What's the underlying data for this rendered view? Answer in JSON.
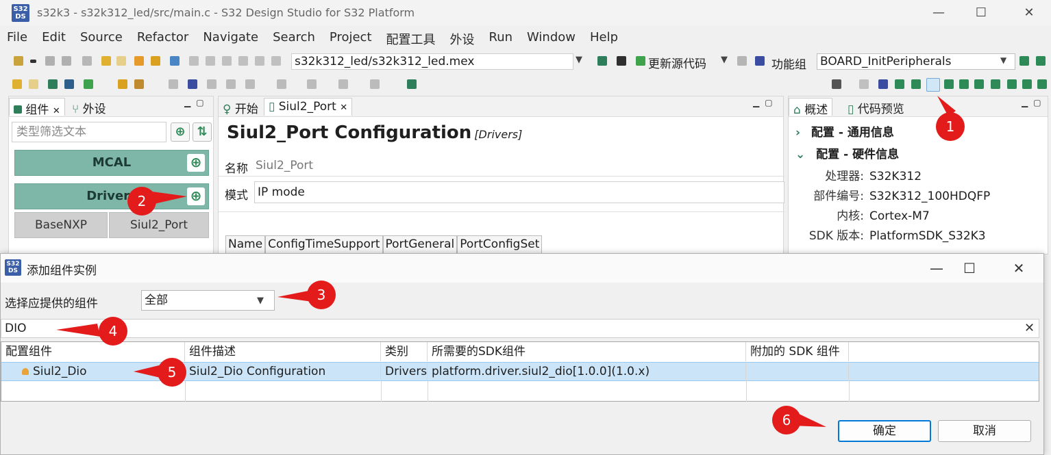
{
  "window": {
    "title": "s32k3 - s32k312_led/src/main.c - S32 Design Studio for S32 Platform",
    "logo_text": "S32 DS",
    "minimize": "—",
    "maximize": "☐",
    "close": "✕"
  },
  "menu": [
    "File",
    "Edit",
    "Source",
    "Refactor",
    "Navigate",
    "Search",
    "Project",
    "配置工具",
    "外设",
    "Run",
    "Window",
    "Help"
  ],
  "toolbar": {
    "mex_file": "s32k312_led/s32k312_led.mex",
    "update_code_label": "更新源代码",
    "function_group_label": "功能组",
    "function_group_value": "BOARD_InitPeripherals"
  },
  "left_panel": {
    "tabs": [
      "组件",
      "外设"
    ],
    "filter_placeholder": "类型筛选文本",
    "groups": [
      {
        "label": "MCAL"
      },
      {
        "label": "Drivers"
      }
    ],
    "items": [
      "BaseNXP",
      "Siul2_Port"
    ]
  },
  "center_panel": {
    "tabs": [
      "开始",
      "Siul2_Port"
    ],
    "heading": "Siul2_Port Configuration",
    "heading_sub": "[Drivers]",
    "name_label": "名称",
    "name_value": "Siul2_Port",
    "mode_label": "模式",
    "mode_value": "IP mode",
    "subtabs": [
      "Name",
      "ConfigTimeSupport",
      "PortGeneral",
      "PortConfigSet"
    ]
  },
  "right_panel": {
    "tabs": [
      "概述",
      "代码预览"
    ],
    "sections": [
      {
        "label": "配置 - 通用信息",
        "chevron": "›"
      },
      {
        "label": "配置 - 硬件信息",
        "chevron": "⌄"
      }
    ],
    "info": [
      {
        "k": "处理器:",
        "v": "S32K312"
      },
      {
        "k": "部件编号:",
        "v": "S32K312_100HDQFP"
      },
      {
        "k": "内核:",
        "v": "Cortex-M7"
      },
      {
        "k": "SDK 版本:",
        "v": "PlatformSDK_S32K3"
      }
    ]
  },
  "dialog": {
    "title": "添加组件实例",
    "provide_label": "选择应提供的组件",
    "provide_value": "全部",
    "search_value": "DIO",
    "columns": [
      "配置组件",
      "组件描述",
      "类别",
      "所需要的SDK组件",
      "附加的 SDK 组件"
    ],
    "row": {
      "component": "Siul2_Dio",
      "description": "Siul2_Dio Configuration",
      "category": "Drivers",
      "sdk": "platform.driver.siul2_dio[1.0.0](1.0.x)",
      "extra": ""
    },
    "ok": "确定",
    "cancel": "取消"
  },
  "callouts": [
    "1",
    "2",
    "3",
    "4",
    "5",
    "6"
  ],
  "colors": {
    "callout": "#e31b1b",
    "green_block": "#7eb6a8",
    "selected_row": "#cce4f7"
  }
}
